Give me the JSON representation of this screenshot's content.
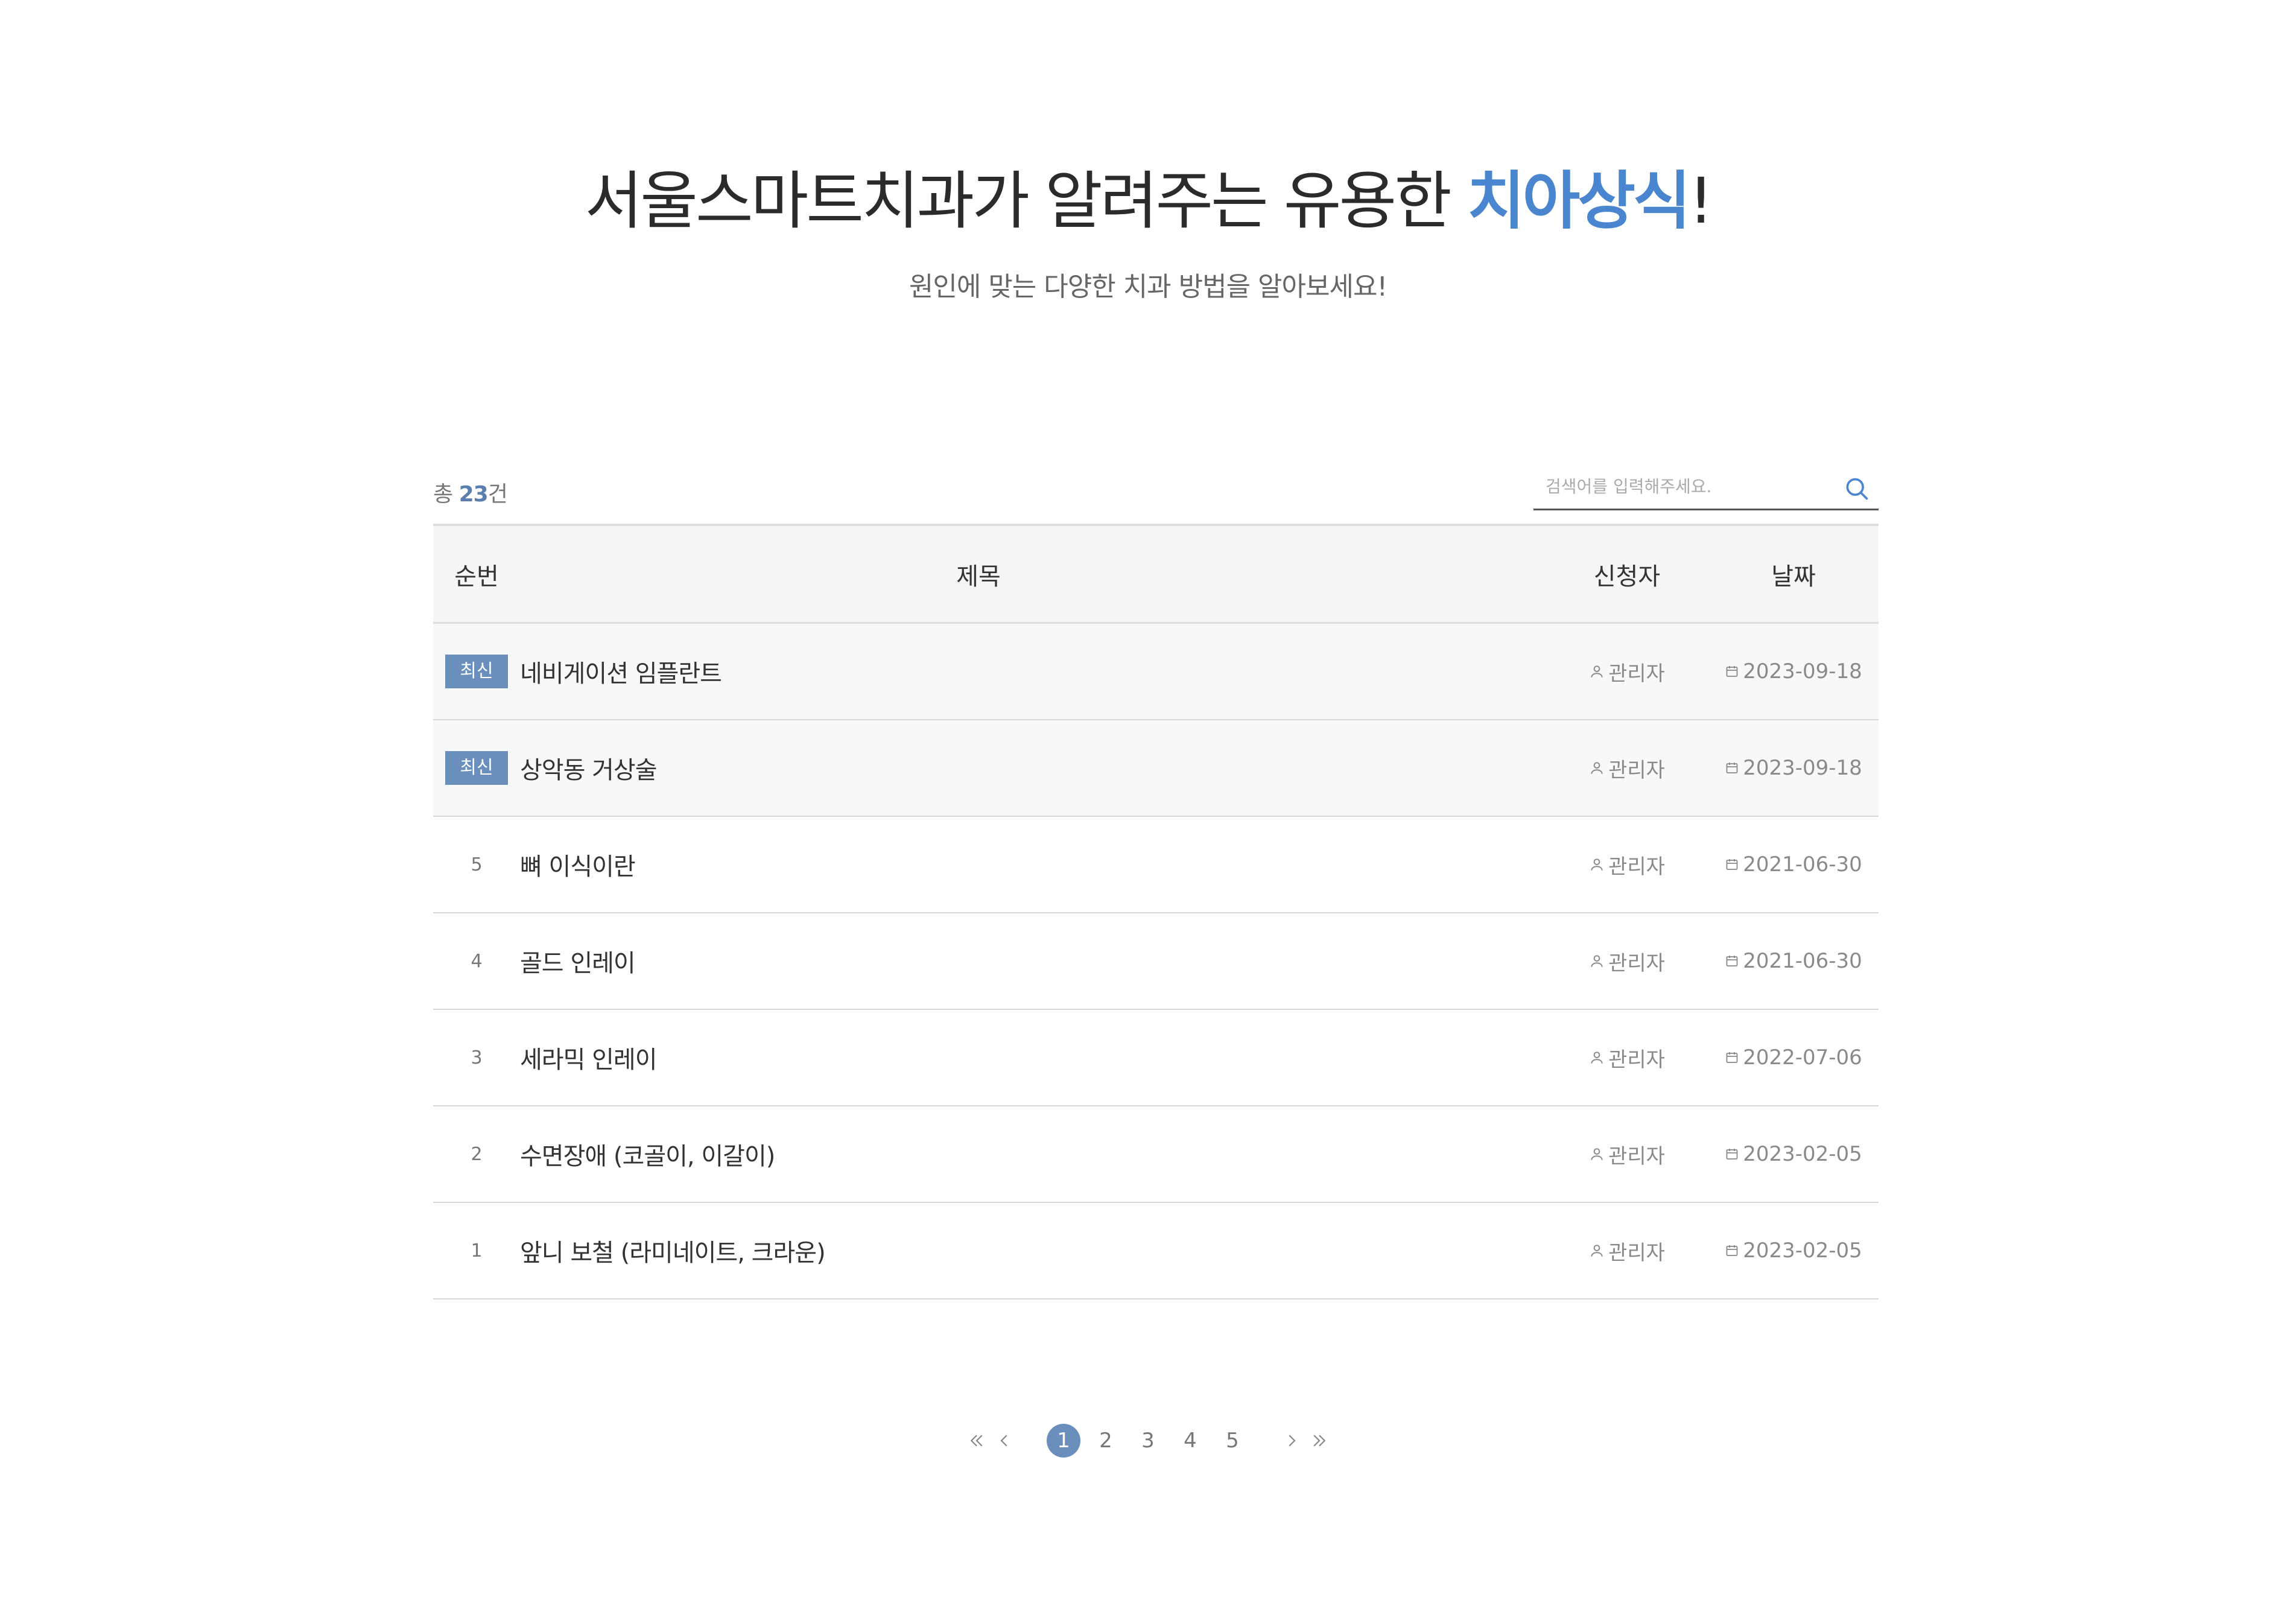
{
  "hero": {
    "title_prefix": "서울스마트치과가 알려주는 유용한 ",
    "title_accent": "치아상식",
    "title_suffix": "!",
    "subtitle": "원인에 맞는 다양한 치과 방법을 알아보세요!"
  },
  "board": {
    "total_prefix": "총 ",
    "total_count": "23",
    "total_suffix": "건",
    "search": {
      "placeholder": "검색어를 입력해주세요.",
      "icon": "search-icon"
    },
    "columns": {
      "no": "순번",
      "title": "제목",
      "author": "신청자",
      "date": "날짜"
    },
    "notice_label": "최신",
    "rows": [
      {
        "no": "최신",
        "title": "네비게이션 임플란트",
        "author": "관리자",
        "date": "2023-09-18"
      },
      {
        "no": "최신",
        "title": "상악동 거상술",
        "author": "관리자",
        "date": "2023-09-18"
      },
      {
        "no": "5",
        "title": "뼈 이식이란",
        "author": "관리자",
        "date": "2021-06-30"
      },
      {
        "no": "4",
        "title": "골드 인레이",
        "author": "관리자",
        "date": "2021-06-30"
      },
      {
        "no": "3",
        "title": "세라믹 인레이",
        "author": "관리자",
        "date": "2022-07-06"
      },
      {
        "no": "2",
        "title": "수면장애 (코골이, 이갈이)",
        "author": "관리자",
        "date": "2023-02-05"
      },
      {
        "no": "1",
        "title": "앞니 보철 (라미네이트, 크라운)",
        "author": "관리자",
        "date": "2023-02-05"
      }
    ]
  },
  "pagination": {
    "first": "«",
    "prev": "‹",
    "pages": [
      "1",
      "2",
      "3",
      "4",
      "5"
    ],
    "current": "1",
    "next": "›",
    "last": "»"
  },
  "colors": {
    "accent": "#4a86cf",
    "badge": "#6a8fbd",
    "border": "#dddddd"
  }
}
